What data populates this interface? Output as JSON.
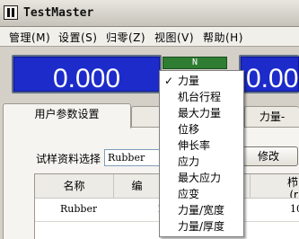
{
  "window": {
    "title": "TestMaster"
  },
  "menu": [
    "管理(M)",
    "设置(S)",
    "归零(Z)",
    "视图(V)",
    "帮助(H)"
  ],
  "display": {
    "value": "0.000",
    "unit": "N",
    "colors": {
      "panel": "#1c2bc9",
      "unit_badge": "#2e7d32"
    }
  },
  "tabs": [
    "用户参数设置",
    "力量-"
  ],
  "form": {
    "label": "试样资料选择",
    "value": "Rubber",
    "modify_label": "修改"
  },
  "table": {
    "headers": [
      "名称",
      "编",
      "栉",
      "(r"
    ],
    "rows": [
      [
        "Rubber",
        "1",
        "10"
      ]
    ]
  },
  "dropdown": {
    "selected": "力量",
    "items": [
      "力量",
      "机台行程",
      "最大力量",
      "位移",
      "伸长率",
      "应力",
      "最大应力",
      "应变",
      "力量/宽度",
      "力量/厚度"
    ]
  }
}
